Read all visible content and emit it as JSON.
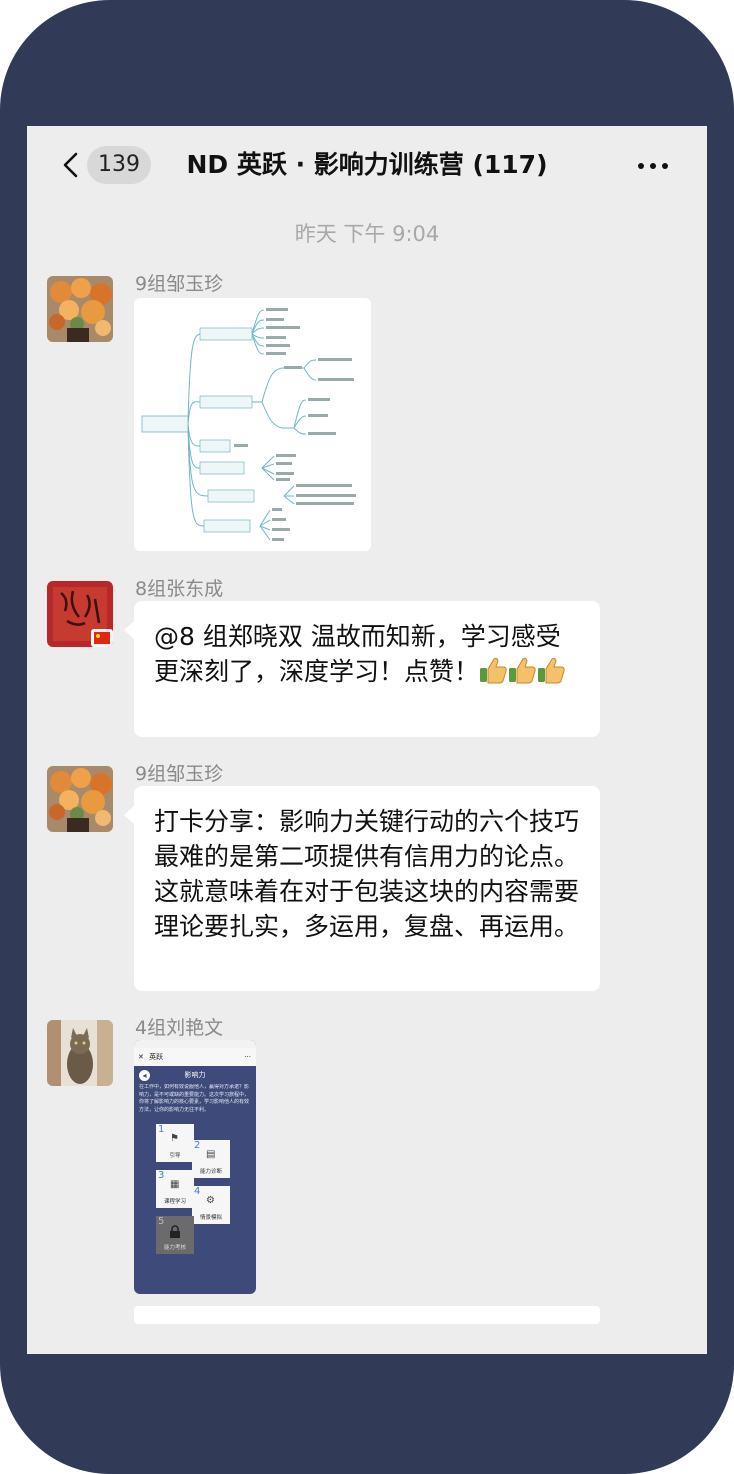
{
  "header": {
    "unread_count": "139",
    "title": "ND 英跃 · 影响力训练营 (117)"
  },
  "timestamp": "昨天 下午 9:04",
  "messages": [
    {
      "sender": "9组邹玉珍",
      "type": "image"
    },
    {
      "sender": "8组张东成",
      "type": "text",
      "text": "@8 组郑晓双 温故而知新，学习感受更深刻了，深度学习！点赞！",
      "emoji": [
        "thumbs-up",
        "thumbs-up",
        "thumbs-up"
      ]
    },
    {
      "sender": "9组邹玉珍",
      "type": "text",
      "text": "打卡分享：影响力关键行动的六个技巧最难的是第二项提供有信用力的论点。这就意味着在对于包装这块的内容需要理论要扎实，多运用，复盘、再运用。"
    },
    {
      "sender": "4组刘艳文",
      "type": "image",
      "image": {
        "nav_title": "英跃",
        "page_title": "影响力",
        "intro": "在工作中，如何有效说服他人，赢得对方承诺？影响力，是不可或缺的重要能力。这次学习旅程中，你将了解影响力的核心要素，学习影响他人的有效方法，让你的影响力无往不利。",
        "cards": [
          {
            "num": "1",
            "label": "引导"
          },
          {
            "num": "2",
            "label": "能力诊断"
          },
          {
            "num": "3",
            "label": "课程学习"
          },
          {
            "num": "4",
            "label": "情景模拟"
          },
          {
            "num": "5",
            "label": "能力考核"
          }
        ]
      }
    }
  ],
  "colors": {
    "phone_frame": "#313a57",
    "chat_bg": "#ededed",
    "bubble": "#ffffff",
    "card_bg": "#3d4a7a"
  }
}
